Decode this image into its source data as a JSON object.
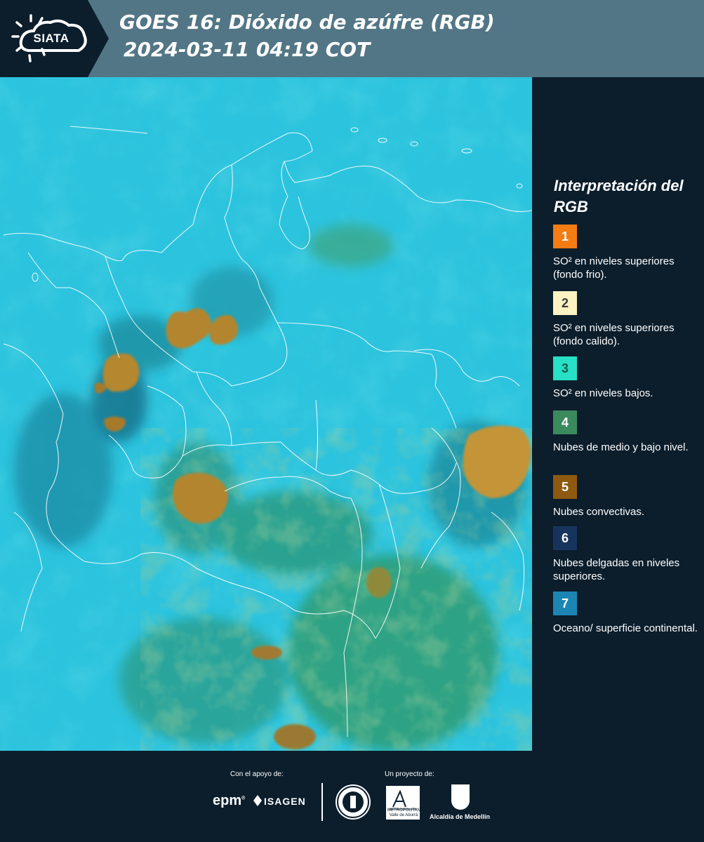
{
  "header": {
    "logo_text": "SIATA",
    "title_line1": "GOES 16: Dióxido de azúfre (RGB)",
    "title_line2": "2024-03-11 04:19 COT",
    "background_color": "#527685"
  },
  "legend": {
    "title": "Interpretación del RGB",
    "items": [
      {
        "number": "1",
        "label": "SO² en niveles superiores (fondo frio).",
        "color": "#f57c12",
        "number_color": "#ffffff"
      },
      {
        "number": "2",
        "label": "SO² en niveles superiores (fondo calido).",
        "color": "#fdf3c2",
        "number_color": "#3a3a3a"
      },
      {
        "number": "3",
        "label": "SO² en niveles bajos.",
        "color": "#27e0c6",
        "number_color": "#1b5a52"
      },
      {
        "number": "4",
        "label": "Nubes de medio y bajo nivel.",
        "color": "#3b8a5e",
        "number_color": "#ffffff"
      },
      {
        "number": "5",
        "label": "Nubes convectivas.",
        "color": "#8e5a0f",
        "number_color": "#ffffff"
      },
      {
        "number": "6",
        "label": "Nubes delgadas en niveles superiores.",
        "color": "#17345e",
        "number_color": "#ffffff"
      },
      {
        "number": "7",
        "label": "Oceano/ superficie continental.",
        "color": "#1b86b4",
        "number_color": "#ffffff"
      }
    ]
  },
  "footer": {
    "support_label": "Con el apoyo de:",
    "project_label": "Un proyecto de:",
    "sponsor_logos": [
      "epm",
      "ISAGEN"
    ],
    "project_logos": [
      "Área Metropolitana Valle de Aburrá",
      "Alcaldía de Medellín"
    ],
    "area_logo_text": "METROPOLITANA Valle de Aburrá",
    "alcaldia_text": "Alcaldía de Medellín"
  }
}
